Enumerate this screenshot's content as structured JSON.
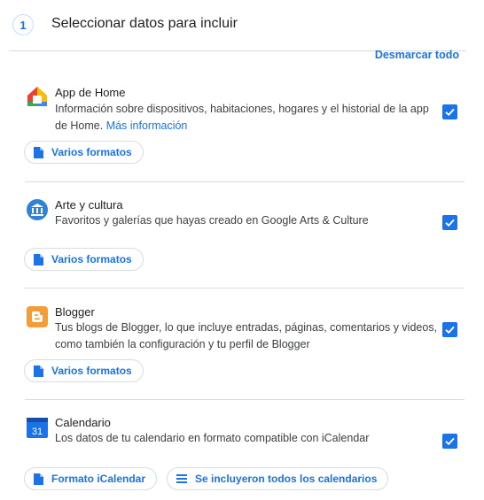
{
  "step": {
    "number": "1",
    "title": "Seleccionar datos para incluir"
  },
  "deselect_all_label": "Desmarcar todo",
  "products": [
    {
      "name": "App de Home",
      "description": "Información sobre dispositivos, habitaciones, hogares y el historial de la app de Home.",
      "more_info": "Más información",
      "checked": true,
      "chips": [
        "Varios formatos"
      ]
    },
    {
      "name": "Arte y cultura",
      "description": "Favoritos y galerías que hayas creado en Google Arts & Culture",
      "checked": true,
      "chips": [
        "Varios formatos"
      ]
    },
    {
      "name": "Blogger",
      "description": "Tus blogs de Blogger, lo que incluye entradas, páginas, comentarios y videos, como también la configuración y tu perfil de Blogger",
      "checked": true,
      "chips": [
        "Varios formatos"
      ]
    },
    {
      "name": "Calendario",
      "icon_text": "31",
      "description": "Los datos de tu calendario en formato compatible con iCalendar",
      "checked": true,
      "chips": [
        "Formato iCalendar",
        "Se incluyeron todos los calendarios"
      ]
    }
  ],
  "icons": {
    "home": "google-home-icon",
    "arts": "arts-and-culture-icon",
    "blogger": "blogger-icon",
    "calendar": "calendar-icon",
    "doc": "document-icon",
    "list": "list-icon",
    "check": "checkmark-icon"
  },
  "colors": {
    "accent": "#1a73e8",
    "divider": "#dadce0",
    "blogger_orange": "#f29d38",
    "arts_blue": "#2d83d6",
    "calendar_blue": "#1a73e8"
  }
}
